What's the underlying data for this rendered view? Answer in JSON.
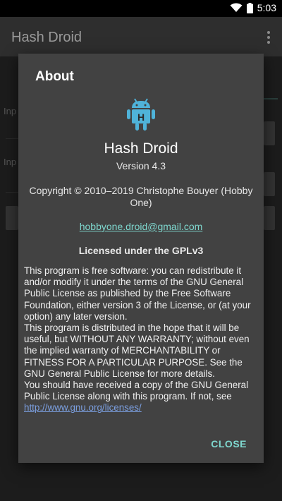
{
  "status_bar": {
    "time": "5:03",
    "wifi_icon": "wifi-icon",
    "battery_icon": "battery-icon"
  },
  "app_bar": {
    "title": "Hash Droid",
    "menu_icon": "overflow-menu-icon"
  },
  "background": {
    "label1": "Inp",
    "label2": "Inp"
  },
  "dialog": {
    "title": "About",
    "logo_icon": "android-h-logo-icon",
    "app_name": "Hash Droid",
    "version": "Version 4.3",
    "copyright": "Copyright © 2010–2019 Christophe Bouyer (Hobby One)",
    "email": "hobbyone.droid@gmail.com",
    "license_heading": "Licensed under the GPLv3",
    "license_p1": "This program is free software: you can redistribute it and/or modify it under the terms of the GNU General Public License as published by the Free Software Foundation, either version 3 of the License, or (at your option) any later version.",
    "license_p2": "This program is distributed in the hope that it will be useful, but WITHOUT ANY WARRANTY; without even the implied warranty of MERCHANTABILITY or FITNESS FOR A PARTICULAR PURPOSE. See the GNU General Public License for more details.",
    "license_p3": "You should have received a copy of the GNU General Public License along with this program. If not, see",
    "license_link": "http://www.gnu.org/licenses/",
    "close_label": "CLOSE"
  },
  "colors": {
    "accent": "#7fd8cf",
    "link": "#7b9fe0",
    "dialog_bg": "#424242",
    "logo": "#4fb3d9"
  }
}
